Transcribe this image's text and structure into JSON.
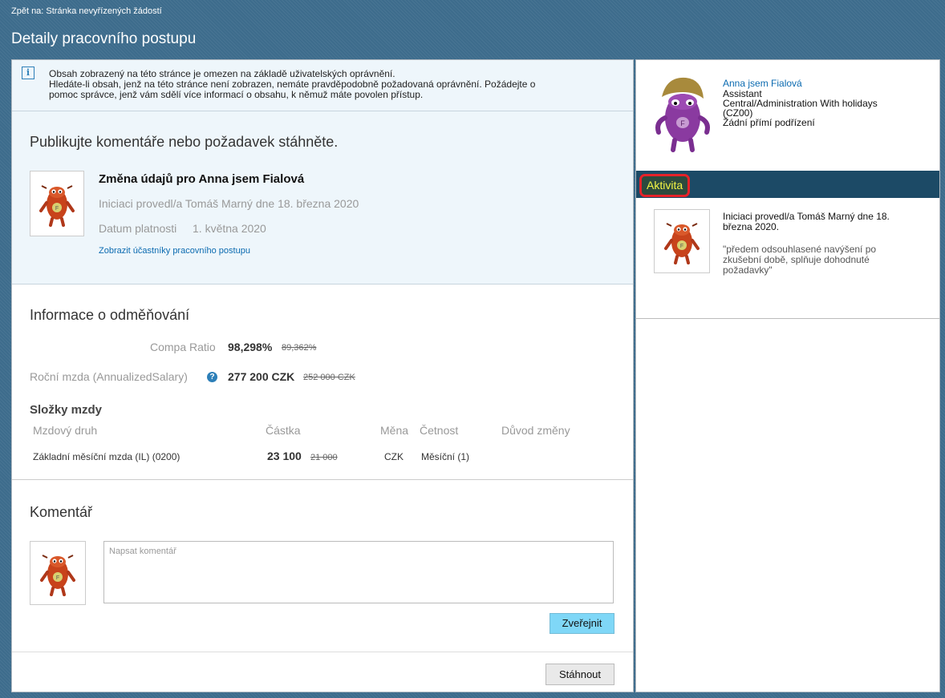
{
  "header": {
    "back_link": "Zpět na: Stránka nevyřízených žádostí",
    "title": "Detaily pracovního postupu"
  },
  "info": {
    "icon": "info-icon",
    "line1": "Obsah zobrazený na této stránce je omezen na základě uživatelských oprávnění.",
    "line2": "Hledáte-li obsah, jenž na této stránce není zobrazen, nemáte pravděpodobně požadovaná oprávnění. Požádejte o",
    "line3": "pomoc správce, jenž vám sdělí více informací o obsahu, k němuž máte povolen přístup."
  },
  "publish": {
    "heading": "Publikujte komentáře nebo požadavek stáhněte.",
    "request_title": "Změna údajů pro Anna jsem Fialová",
    "initiated": "Iniciaci provedl/a Tomáš Marný dne 18. března 2020",
    "effective_label": "Datum platnosti",
    "effective_date": "1. května 2020",
    "participants_link": "Zobrazit účastníky pracovního postupu"
  },
  "compensation": {
    "heading": "Informace o odměňování",
    "compa_label": "Compa Ratio",
    "compa_value": "98,298%",
    "compa_old": "89,362%",
    "salary_label": "Roční mzda (AnnualizedSalary)",
    "salary_value": "277 200 CZK",
    "salary_old": "252 000 CZK",
    "components_title": "Složky mzdy",
    "columns": [
      "Mzdový druh",
      "Částka",
      "Měna",
      "Četnost",
      "Důvod změny"
    ],
    "row": {
      "type": "Základní měsíční mzda (IL) (0200)",
      "amount": "23 100",
      "amount_old": "21 000",
      "currency": "CZK",
      "frequency": "Měsíční (1)",
      "reason": ""
    }
  },
  "comment": {
    "heading": "Komentář",
    "placeholder": "Napsat komentář",
    "publish_button": "Zveřejnit"
  },
  "withdraw_button": "Stáhnout",
  "profile": {
    "name": "Anna jsem Fialová",
    "position": "Assistant",
    "department": "Central/Administration With holidays",
    "department_code": "(CZ00)",
    "reports": "Žádní přímí podřízení"
  },
  "activity": {
    "label": "Aktivita",
    "line1": "Iniciaci provedl/a Tomáš Marný dne 18.",
    "line2": "března 2020.",
    "quote1": "\"předem odsouhlasené navýšení po",
    "quote2": "zkušební době, splňuje dohodnuté",
    "quote3": "požadavky\""
  },
  "colors": {
    "header_bg": "#3d6c8c",
    "info_bg": "#eef6fb",
    "activity_bar": "#1c4a66",
    "activity_text": "#f3f545",
    "highlight_border": "#e52229",
    "publish_button": "#7fd7f7",
    "link": "#0a6ab0"
  }
}
